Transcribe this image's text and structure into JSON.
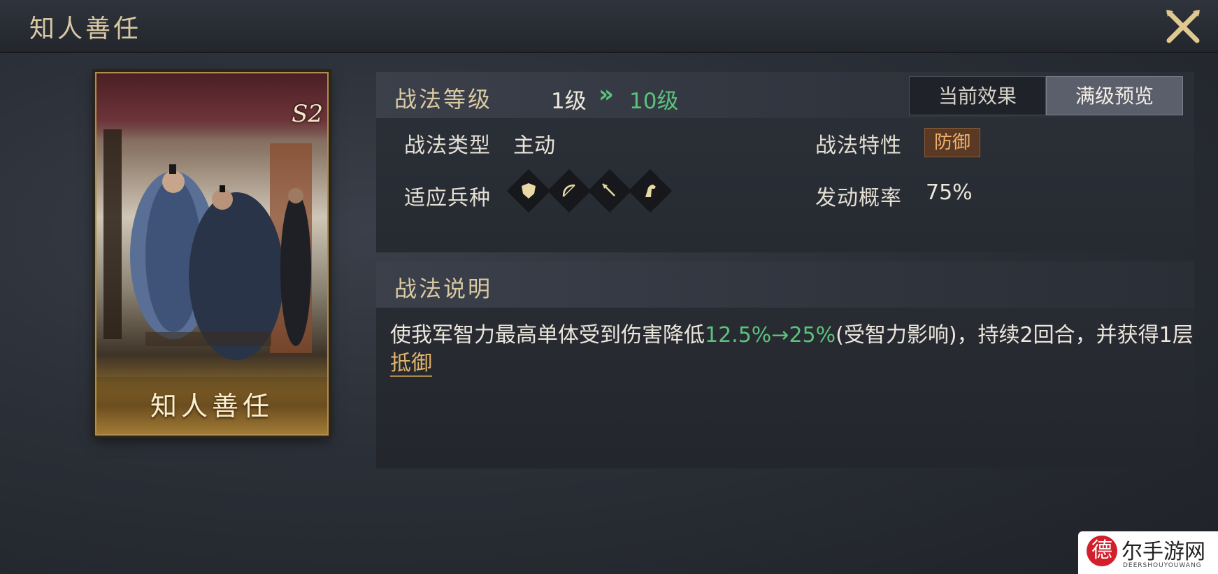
{
  "header": {
    "title": "知人善任",
    "close_icon": "close-icon"
  },
  "card": {
    "name": "知人善任",
    "season_badge": "S2"
  },
  "level": {
    "label": "战法等级",
    "from": "1级",
    "arrow": "»",
    "to": "10级"
  },
  "tabs": [
    {
      "label": "当前效果",
      "active": false
    },
    {
      "label": "满级预览",
      "active": true
    }
  ],
  "attributes": {
    "type_label": "战法类型",
    "type_value": "主动",
    "trait_label": "战法特性",
    "trait_value": "防御",
    "troop_label": "适应兵种",
    "troops": [
      "shield-icon",
      "bow-icon",
      "spear-icon",
      "horse-icon"
    ],
    "rate_label": "发动概率",
    "rate_value": "75%"
  },
  "description": {
    "title": "战法说明",
    "text_part1": "使我军智力最高单体受到伤害降低",
    "highlight": "12.5%→25%",
    "text_part2": "(受智力影响)，持续2回合，并获得1层",
    "keyword": "抵御"
  },
  "watermark": {
    "logo": "德",
    "text": "尔手游网",
    "sub": "DEERSHOUYOUWANG"
  },
  "colors": {
    "accent_green": "#5bc27b",
    "gold": "#d9c9a3",
    "keyword": "#e0b46a"
  }
}
